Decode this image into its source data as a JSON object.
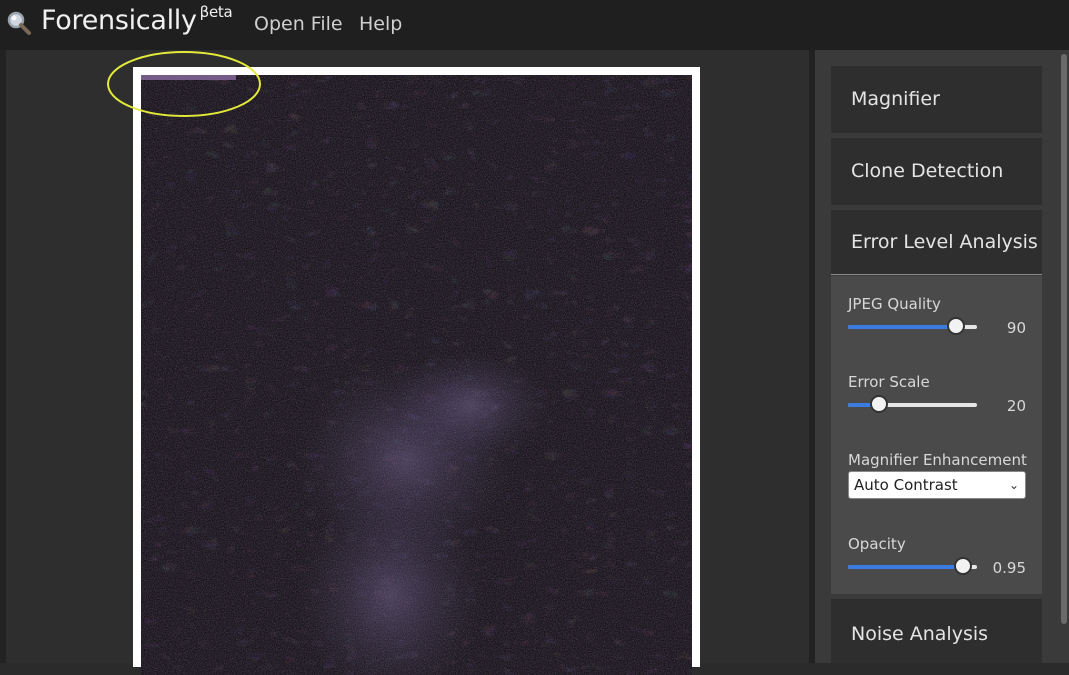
{
  "app": {
    "title": "Forensically",
    "title_sup": "βeta"
  },
  "menu": {
    "open_file": "Open File",
    "help": "Help"
  },
  "panels": {
    "magnifier": "Magnifier",
    "clone_detection": "Clone Detection",
    "error_level_analysis": "Error Level Analysis",
    "noise_analysis": "Noise Analysis"
  },
  "ela": {
    "jpeg_quality": {
      "label": "JPEG Quality",
      "value": "90",
      "fraction": 0.84
    },
    "error_scale": {
      "label": "Error Scale",
      "value": "20",
      "fraction": 0.24
    },
    "magnifier_enhancement": {
      "label": "Magnifier Enhancement",
      "selected": "Auto Contrast"
    },
    "opacity": {
      "label": "Opacity",
      "value": "0.95",
      "fraction": 0.89
    }
  },
  "colors": {
    "accent": "#3a7ce0",
    "highlight": "#e3ea3a"
  },
  "icons": {
    "logo": "magnifier-icon",
    "select": "chevron-down-icon"
  }
}
